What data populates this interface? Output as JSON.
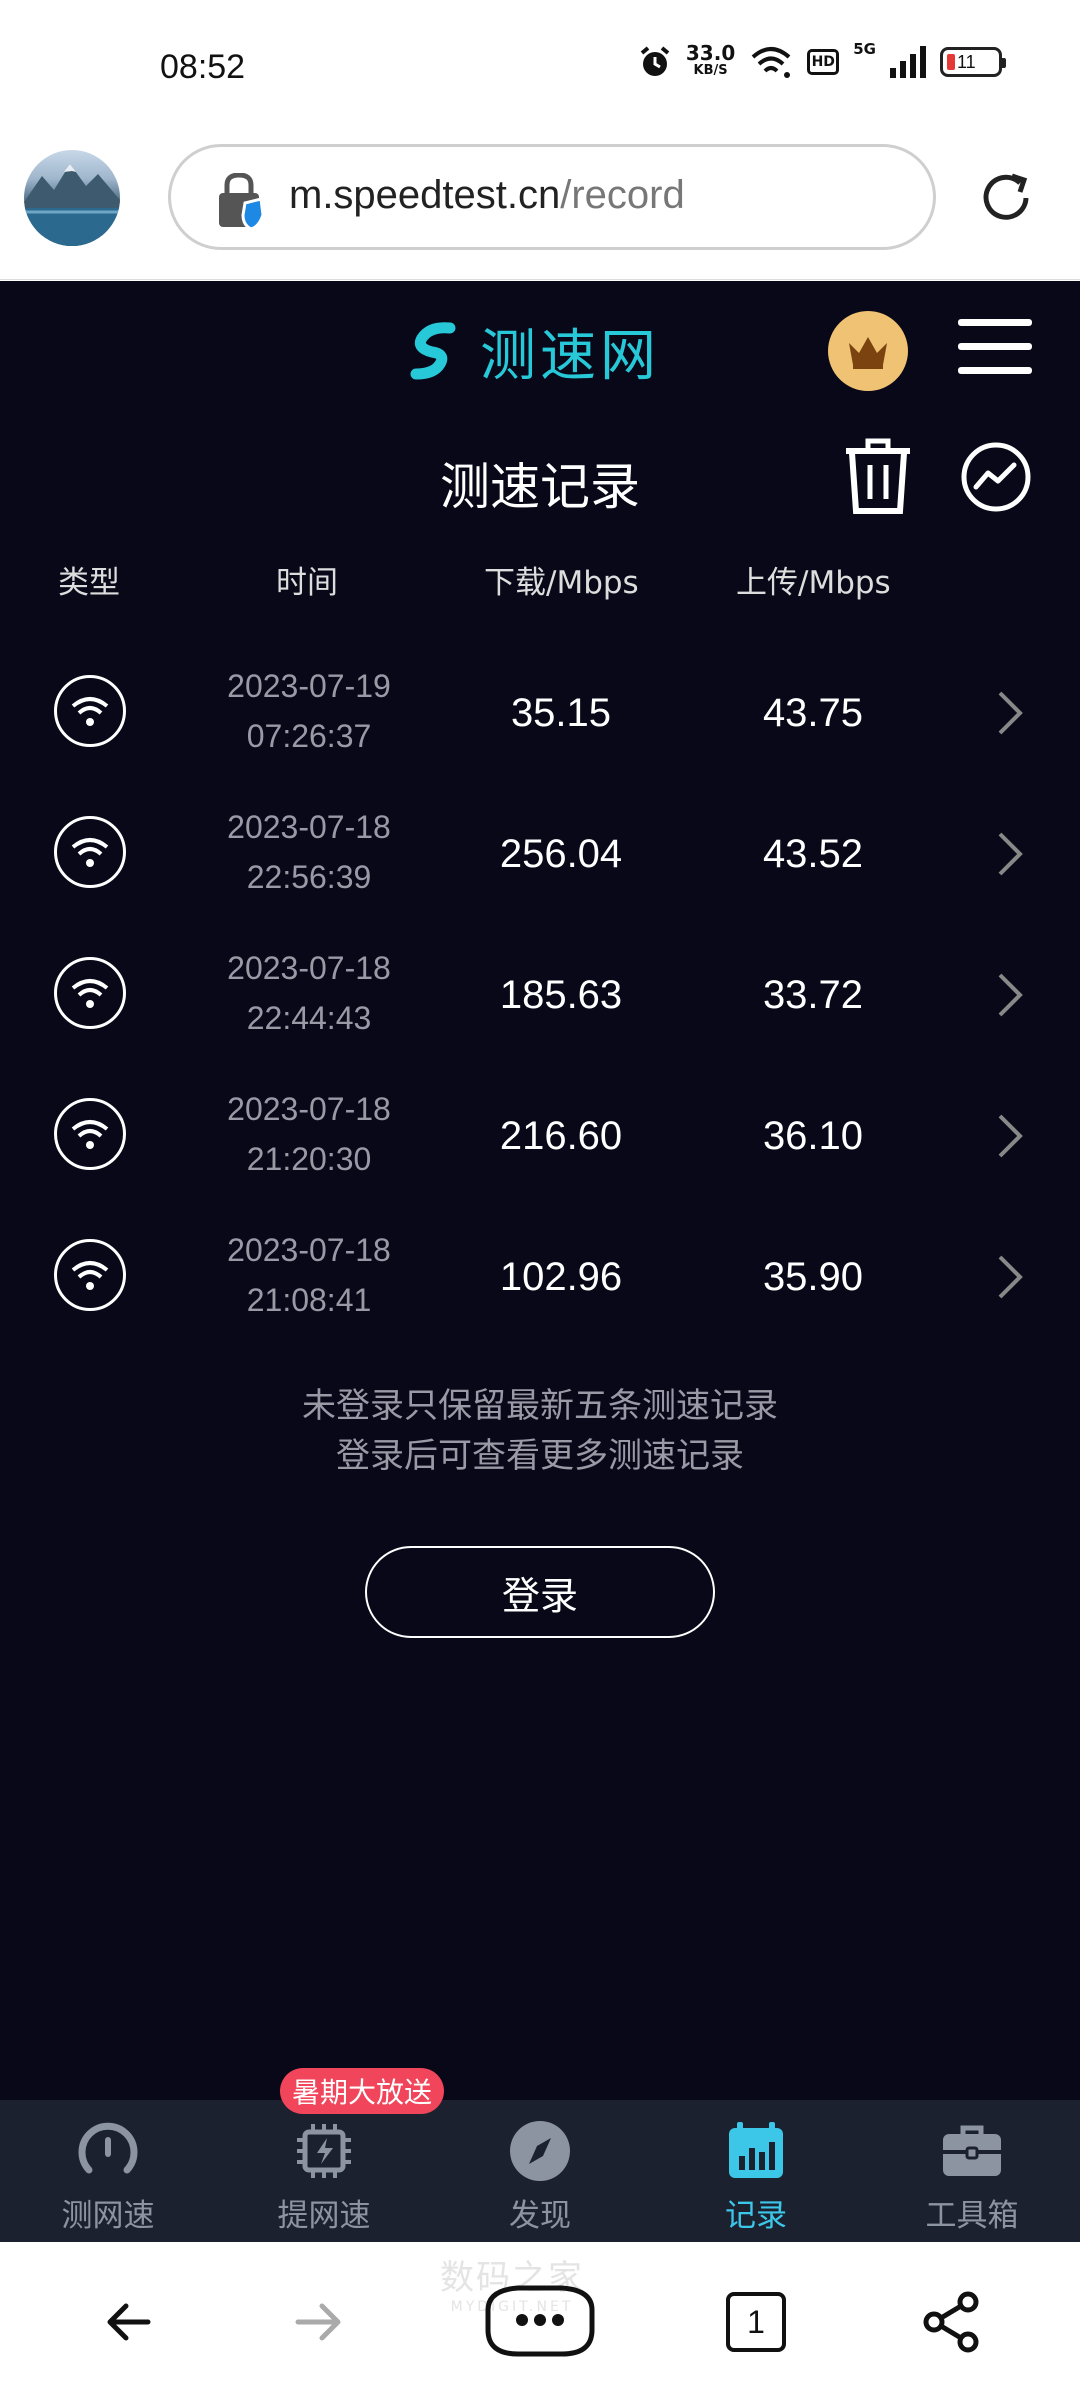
{
  "status_bar": {
    "time": "08:52",
    "net_speed_value": "33.0",
    "net_speed_unit": "KB/S",
    "hd_label": "HD",
    "network_label": "5G",
    "battery": "11",
    "icons": [
      "alarm-icon",
      "wifi-icon",
      "signal-icon",
      "battery-icon"
    ]
  },
  "browser": {
    "url_host": "m.speedtest.cn",
    "url_path": "/record"
  },
  "header": {
    "brand": "测速网"
  },
  "page": {
    "title": "测速记录"
  },
  "table": {
    "headers": {
      "type": "类型",
      "time": "时间",
      "download": "下载/Mbps",
      "upload": "上传/Mbps"
    },
    "rows": [
      {
        "date": "2023-07-19",
        "time": "07:26:37",
        "download": "35.15",
        "upload": "43.75"
      },
      {
        "date": "2023-07-18",
        "time": "22:56:39",
        "download": "256.04",
        "upload": "43.52"
      },
      {
        "date": "2023-07-18",
        "time": "22:44:43",
        "download": "185.63",
        "upload": "33.72"
      },
      {
        "date": "2023-07-18",
        "time": "21:20:30",
        "download": "216.60",
        "upload": "36.10"
      },
      {
        "date": "2023-07-18",
        "time": "21:08:41",
        "download": "102.96",
        "upload": "35.90"
      }
    ]
  },
  "notice": {
    "line1": "未登录只保留最新五条测速记录",
    "line2": "登录后可查看更多测速记录"
  },
  "login_label": "登录",
  "tabs": [
    {
      "label": "测网速",
      "icon": "speedometer-icon"
    },
    {
      "label": "提网速",
      "icon": "chip-icon"
    },
    {
      "label": "发现",
      "icon": "compass-icon"
    },
    {
      "label": "记录",
      "icon": "bar-chart-icon",
      "active": true
    },
    {
      "label": "工具箱",
      "icon": "toolbox-icon"
    }
  ],
  "promo_badge": "暑期大放送",
  "browser_nav": {
    "tab_count": "1"
  },
  "watermark": {
    "text": "数码之家",
    "sub": "MYDIGIT.NET"
  },
  "colors": {
    "page_bg": "#080818",
    "accent": "#27c9d8",
    "tab_bar_bg": "#1c2130",
    "promo": "#f0455a",
    "crown_bg": "#f0c274"
  }
}
